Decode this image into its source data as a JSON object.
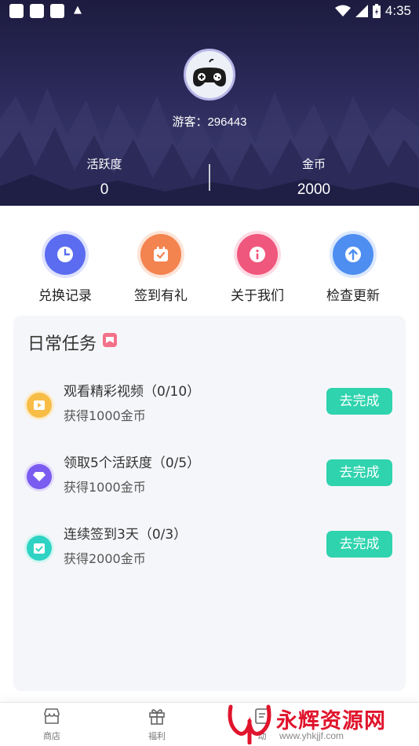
{
  "status_bar": {
    "time": "4:35"
  },
  "profile": {
    "username": "游客：296443"
  },
  "stats": [
    {
      "label": "活跃度",
      "value": "0"
    },
    {
      "label": "金币",
      "value": "2000"
    }
  ],
  "quick_actions": [
    {
      "label": "兑换记录",
      "icon": "clock-icon",
      "color": "#5b6cf0"
    },
    {
      "label": "签到有礼",
      "icon": "calendar-check-icon",
      "color": "#f3834f"
    },
    {
      "label": "关于我们",
      "icon": "info-icon",
      "color": "#f0577d"
    },
    {
      "label": "检查更新",
      "icon": "arrow-up-icon",
      "color": "#4d8ef0"
    }
  ],
  "daily_tasks": {
    "title": "日常任务",
    "items": [
      {
        "name": "观看精彩视频（0/10）",
        "reward": "获得1000金币",
        "button": "去完成",
        "icon": "video-icon",
        "color": "#f7bd47"
      },
      {
        "name": "领取5个活跃度（0/5）",
        "reward": "获得1000金币",
        "button": "去完成",
        "icon": "diamond-icon",
        "color": "#7b5cf0"
      },
      {
        "name": "连续签到3天（0/3）",
        "reward": "获得2000金币",
        "button": "去完成",
        "icon": "checkin-icon",
        "color": "#2fd3c4"
      }
    ]
  },
  "bottom_nav": [
    {
      "label": "商店",
      "icon": "shop-icon"
    },
    {
      "label": "福利",
      "icon": "gift-icon"
    },
    {
      "label": "动",
      "icon": "activity-icon"
    }
  ],
  "watermark": {
    "text": "永辉资源网",
    "url": "www.yhkjjf.com"
  },
  "colors": {
    "accent": "#2fd3ae",
    "header_bg": "#2b2a5a"
  }
}
